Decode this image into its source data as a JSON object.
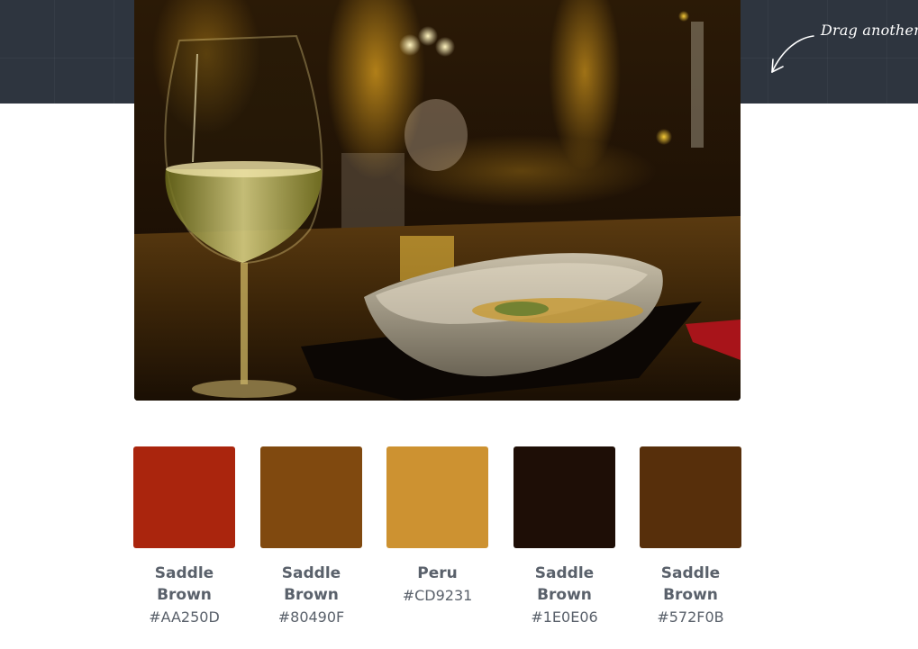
{
  "hint": {
    "text": "Drag another f",
    "icon": "curved-arrow-icon"
  },
  "photo": {
    "icon": "restaurant-photo"
  },
  "palette": [
    {
      "name_line1": "Saddle",
      "name_line2": "Brown",
      "hex": "#AA250D",
      "color": "#AA250D"
    },
    {
      "name_line1": "Saddle",
      "name_line2": "Brown",
      "hex": "#80490F",
      "color": "#80490F"
    },
    {
      "name_line1": "Peru",
      "name_line2": "",
      "hex": "#CD9231",
      "color": "#CD9231"
    },
    {
      "name_line1": "Saddle",
      "name_line2": "Brown",
      "hex": "#1E0E06",
      "color": "#1E0E06"
    },
    {
      "name_line1": "Saddle",
      "name_line2": "Brown",
      "hex": "#572F0B",
      "color": "#572F0B"
    }
  ]
}
